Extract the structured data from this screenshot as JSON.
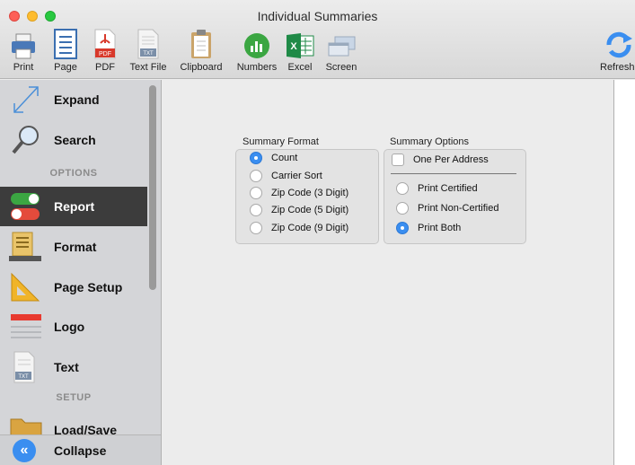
{
  "window": {
    "title": "Individual Summaries"
  },
  "toolbar": {
    "items": [
      {
        "label": "Print",
        "icon": "printer-icon"
      },
      {
        "label": "Page",
        "icon": "page-icon"
      },
      {
        "label": "PDF",
        "icon": "pdf-icon"
      },
      {
        "label": "Text File",
        "icon": "text-file-icon"
      },
      {
        "label": "Clipboard",
        "icon": "clipboard-icon"
      },
      {
        "label": "Numbers",
        "icon": "numbers-icon"
      },
      {
        "label": "Excel",
        "icon": "excel-icon"
      },
      {
        "label": "Screen",
        "icon": "screen-icon"
      },
      {
        "label": "Refresh",
        "icon": "refresh-icon"
      }
    ]
  },
  "sidebar": {
    "items": [
      {
        "label": "Expand",
        "icon": "expand-icon"
      },
      {
        "label": "Search",
        "icon": "search-icon"
      },
      {
        "label": "Report",
        "icon": "toggle-switches-icon",
        "active": true
      },
      {
        "label": "Format",
        "icon": "format-icon"
      },
      {
        "label": "Page Setup",
        "icon": "triangle-ruler-icon"
      },
      {
        "label": "Logo",
        "icon": "logo-icon"
      },
      {
        "label": "Text",
        "icon": "text-icon"
      },
      {
        "label": "Load/Save",
        "icon": "folder-icon"
      }
    ],
    "sections": {
      "options": "OPTIONS",
      "setup": "SETUP"
    },
    "collapse_label": "Collapse",
    "collapse_glyph": "«"
  },
  "summary_format": {
    "title": "Summary Format",
    "options": [
      "Count",
      "Carrier Sort",
      "Zip Code (3 Digit)",
      "Zip Code (5 Digit)",
      "Zip Code (9 Digit)"
    ],
    "selected": "Count"
  },
  "summary_options": {
    "title": "Summary Options",
    "checkbox_label": "One Per Address",
    "checkbox_checked": false,
    "options": [
      "Print Certified",
      "Print Non-Certified",
      "Print Both"
    ],
    "selected": "Print Both"
  },
  "colors": {
    "accent": "#3a8ef0",
    "sidebar_active": "#3c3c3c",
    "numbers_green": "#3ba642",
    "excel_green": "#1f8a47",
    "pdf_red": "#d8392b"
  }
}
